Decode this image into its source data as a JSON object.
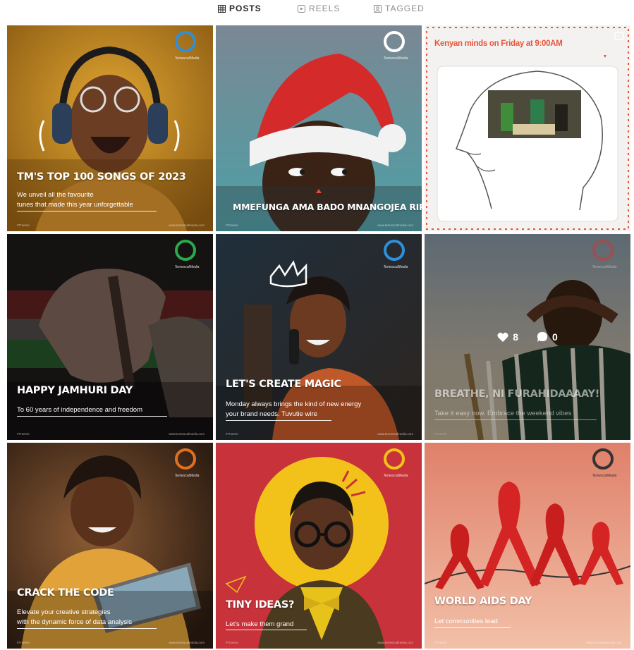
{
  "tabs": [
    {
      "label": "POSTS",
      "icon": "grid-icon",
      "active": true
    },
    {
      "label": "REELS",
      "icon": "reels-icon",
      "active": false
    },
    {
      "label": "TAGGED",
      "icon": "tagged-icon",
      "active": false
    }
  ],
  "brand_name": "TemescalMedia",
  "footer_handle": "#Tmeme",
  "footer_url": "www.temescalmedia.com",
  "posts": [
    {
      "headline": "TM'S TOP 100 SONGS OF 2023",
      "subtitle_lines": [
        "We unveil all the favourite",
        "tunes that made this year unforgettable"
      ],
      "logo_color": "#2f8fd8"
    },
    {
      "headline": "MMEFUNGA AMA BADO MNANGOJEA RIPOTI?",
      "logo_color": "#ffffff"
    },
    {
      "headline": "Kenyan minds on Friday at 9:00AM",
      "accent": "#e8553a"
    },
    {
      "headline": "HAPPY JAMHURI DAY",
      "subtitle_lines": [
        "To 60 years of independence and freedom"
      ],
      "logo_color": "#2aa84a"
    },
    {
      "headline": "LET'S CREATE MAGIC",
      "subtitle_lines": [
        "Monday always brings the kind of new energy",
        "your brand needs. Tuvutie wire"
      ],
      "logo_color": "#2f8fd8"
    },
    {
      "headline": "BREATHE, NI FURAHIDAAAAY!",
      "subtitle_lines": [
        "Take it easy now. Embrace the weekend vibes"
      ],
      "likes": "8",
      "comments": "0",
      "logo_color": "#c83a3a"
    },
    {
      "headline": "CRACK THE CODE",
      "subtitle_lines": [
        "Elevate your creative strategies",
        "with the dynamic force of data analysis"
      ],
      "logo_color": "#e07020"
    },
    {
      "headline": "TINY IDEAS?",
      "subtitle_lines": [
        "Let's make them grand"
      ],
      "logo_color": "#f2c21a"
    },
    {
      "headline": "WORLD AIDS DAY",
      "subtitle_lines": [
        "Let communities lead"
      ],
      "logo_color": "#333333"
    }
  ]
}
